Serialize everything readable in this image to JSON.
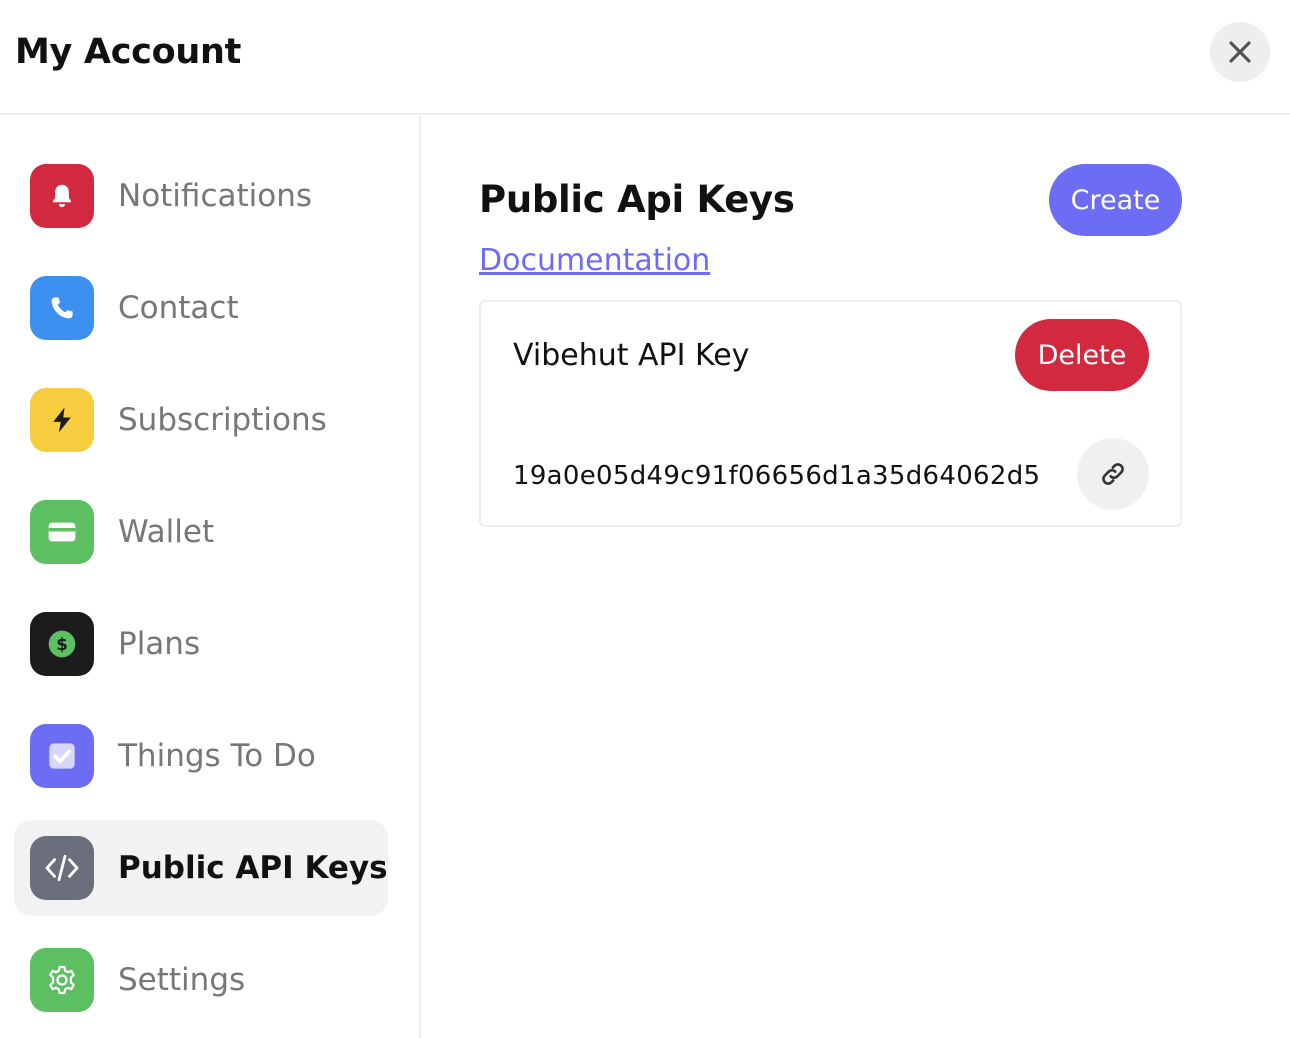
{
  "header": {
    "title": "My Account",
    "close_icon": "close-icon"
  },
  "sidebar": {
    "items": [
      {
        "label": "Notifications",
        "icon": "bell-icon",
        "color": "#d2293f",
        "active": false
      },
      {
        "label": "Contact",
        "icon": "phone-icon",
        "color": "#3d8ff0",
        "active": false
      },
      {
        "label": "Subscriptions",
        "icon": "lightning-icon",
        "color": "#f5cd3f",
        "active": false
      },
      {
        "label": "Wallet",
        "icon": "credit-card-icon",
        "color": "#5cbf62",
        "active": false
      },
      {
        "label": "Plans",
        "icon": "dollar-icon",
        "color": "#1c1c1e",
        "active": false
      },
      {
        "label": "Things To Do",
        "icon": "checkbox-icon",
        "color": "#6c6cf5",
        "active": false
      },
      {
        "label": "Public API Keys",
        "icon": "code-icon",
        "color": "#6b6f7c",
        "active": true
      },
      {
        "label": "Settings",
        "icon": "gear-icon",
        "color": "#5cbf62",
        "active": false
      }
    ]
  },
  "main": {
    "title": "Public Api Keys",
    "create_label": "Create",
    "doc_link": "Documentation",
    "keys": [
      {
        "name": "Vibehut API Key",
        "delete_label": "Delete",
        "value": "19a0e05d49c91f06656d1a35d64062d5",
        "copy_icon": "link-icon"
      }
    ]
  },
  "colors": {
    "accent": "#6c6cf5",
    "danger": "#d2293f",
    "active_bg": "#f2f2f2"
  }
}
